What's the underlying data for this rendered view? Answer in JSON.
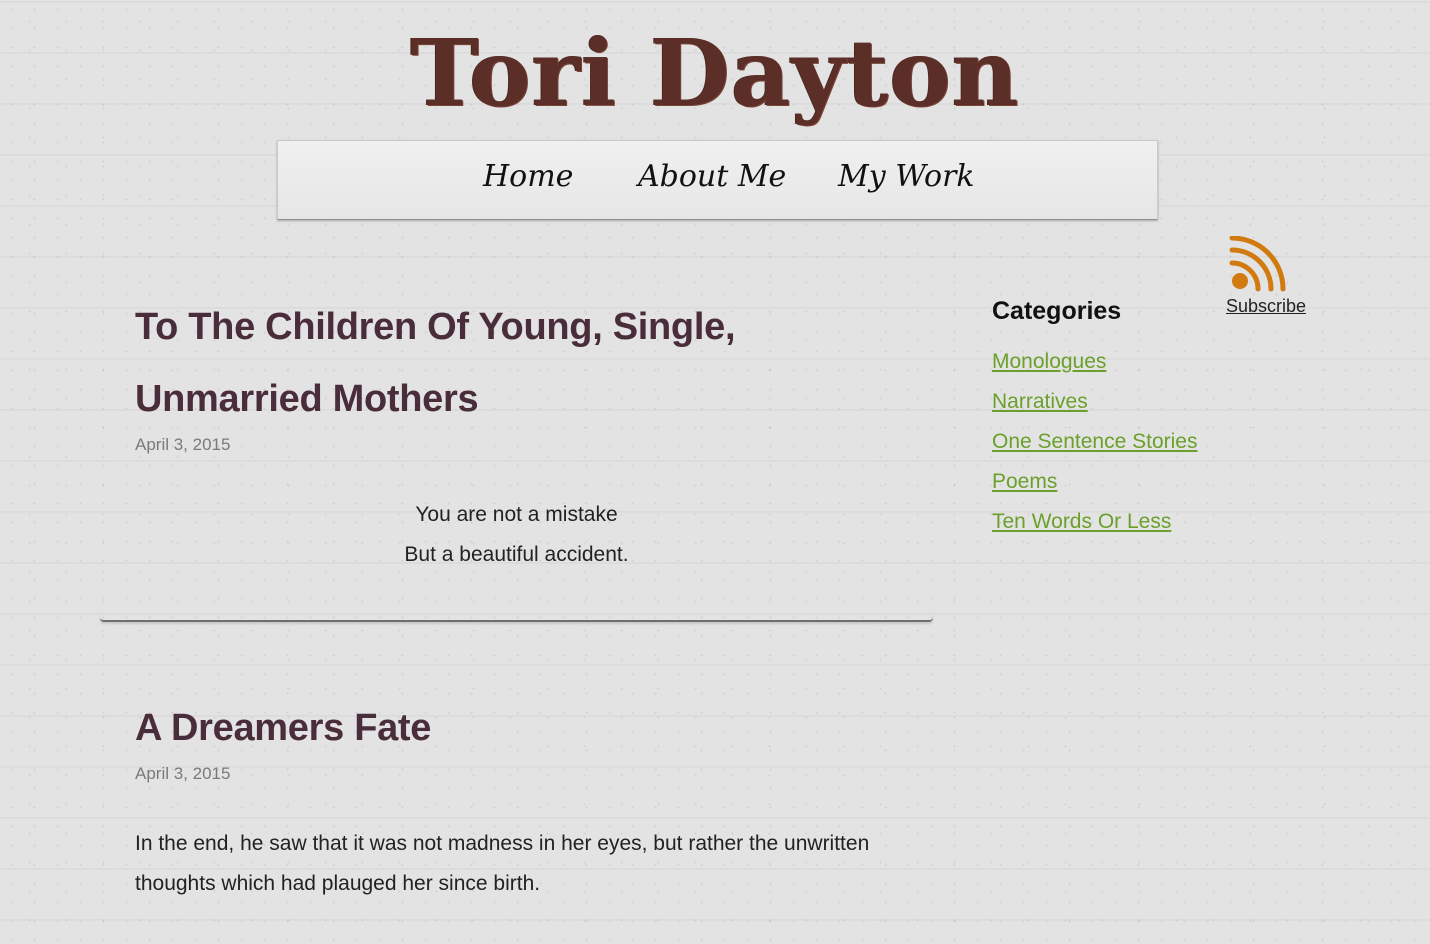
{
  "site": {
    "title": "Tori Dayton"
  },
  "nav": {
    "items": [
      {
        "label": "Home"
      },
      {
        "label": "About Me"
      },
      {
        "label": "My Work"
      }
    ]
  },
  "rss": {
    "icon": "rss-feed-icon",
    "label": "Subscribe",
    "color": "#d07a10"
  },
  "sidebar": {
    "heading": "Categories",
    "categories": [
      {
        "label": "Monologues"
      },
      {
        "label": "Narratives"
      },
      {
        "label": "One Sentence Stories"
      },
      {
        "label": "Poems"
      },
      {
        "label": "Ten Words Or Less"
      }
    ],
    "link_color": "#6aa02b"
  },
  "posts": [
    {
      "title": "To The Children Of Young, Single, Unmarried Mothers",
      "date": "April 3, 2015",
      "lines": [
        "You are not a mistake",
        "But a beautiful accident."
      ]
    },
    {
      "title": "A Dreamers Fate",
      "date": "April 3, 2015",
      "lines": [
        "In the end, he saw that it was not madness in her eyes, but rather the unwritten",
        "thoughts which had plauged her since birth."
      ]
    }
  ]
}
